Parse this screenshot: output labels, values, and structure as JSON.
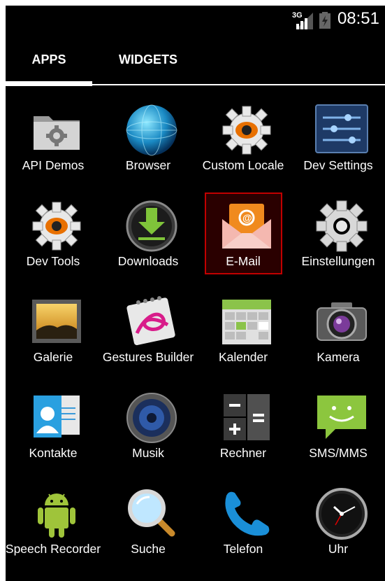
{
  "status_bar": {
    "network": "3G",
    "time": "08:51"
  },
  "tabs": [
    {
      "label": "APPS",
      "selected": true
    },
    {
      "label": "WIDGETS",
      "selected": false
    }
  ],
  "apps": [
    {
      "label": "API Demos",
      "icon": "folder-gear-icon"
    },
    {
      "label": "Browser",
      "icon": "globe-icon"
    },
    {
      "label": "Custom Locale",
      "icon": "gear-orange-icon"
    },
    {
      "label": "Dev Settings",
      "icon": "sliders-icon"
    },
    {
      "label": "Dev Tools",
      "icon": "gear-orange-icon"
    },
    {
      "label": "Downloads",
      "icon": "download-icon"
    },
    {
      "label": "E-Mail",
      "icon": "email-icon",
      "selected": true
    },
    {
      "label": "Einstellungen",
      "icon": "gear-icon"
    },
    {
      "label": "Galerie",
      "icon": "gallery-icon"
    },
    {
      "label": "Gestures Builder",
      "icon": "gesture-icon"
    },
    {
      "label": "Kalender",
      "icon": "calendar-icon"
    },
    {
      "label": "Kamera",
      "icon": "camera-icon"
    },
    {
      "label": "Kontakte",
      "icon": "contacts-icon"
    },
    {
      "label": "Musik",
      "icon": "speaker-icon"
    },
    {
      "label": "Rechner",
      "icon": "calculator-icon"
    },
    {
      "label": "SMS/MMS",
      "icon": "chat-bubble-icon"
    },
    {
      "label": "Speech Recorder",
      "icon": "android-icon"
    },
    {
      "label": "Suche",
      "icon": "magnifier-icon"
    },
    {
      "label": "Telefon",
      "icon": "phone-icon"
    },
    {
      "label": "Uhr",
      "icon": "clock-icon"
    }
  ],
  "colors": {
    "background": "#000000",
    "selection_border": "#c10000"
  }
}
